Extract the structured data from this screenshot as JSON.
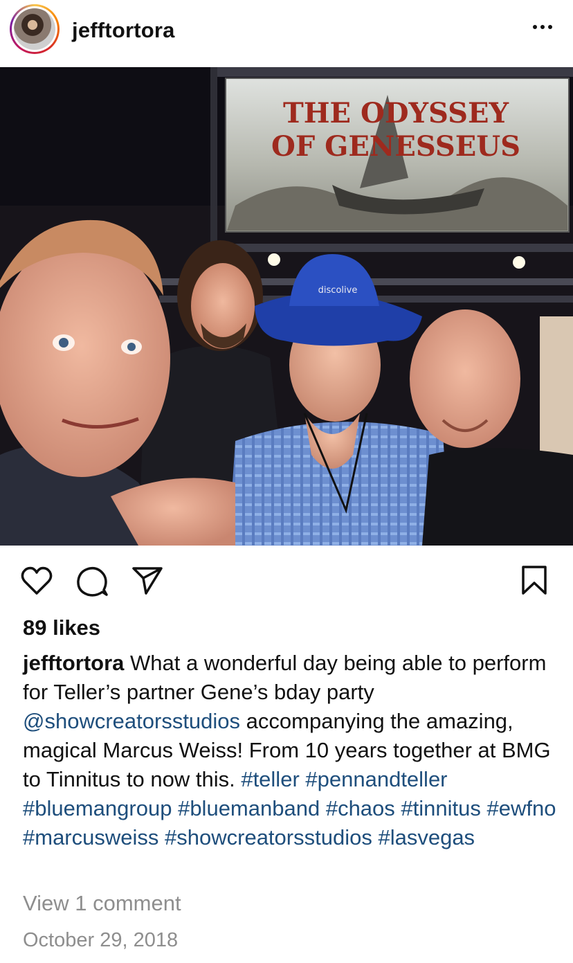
{
  "post": {
    "username": "jefftortora",
    "likes": "89 likes",
    "caption_user": "jefftortora",
    "caption_segments": [
      {
        "text": " What a wonderful day being able to perform for Teller’s partner Gene’s bday party ",
        "link": false
      },
      {
        "text": "@showcreatorsstudios",
        "link": true
      },
      {
        "text": " accompanying the amazing, magical Marcus Weiss! From 10 years together at BMG to Tinnitus to now this. ",
        "link": false
      },
      {
        "text": "#teller",
        "link": true
      },
      {
        "text": " ",
        "link": false
      },
      {
        "text": "#pennandteller",
        "link": true
      },
      {
        "text": " ",
        "link": false
      },
      {
        "text": "#bluemangroup",
        "link": true
      },
      {
        "text": " ",
        "link": false
      },
      {
        "text": "#bluemanband",
        "link": true
      },
      {
        "text": " ",
        "link": false
      },
      {
        "text": "#chaos",
        "link": true
      },
      {
        "text": " ",
        "link": false
      },
      {
        "text": "#tinnitus",
        "link": true
      },
      {
        "text": " ",
        "link": false
      },
      {
        "text": "#ewfno",
        "link": true
      },
      {
        "text": " ",
        "link": false
      },
      {
        "text": "#marcusweiss",
        "link": true
      },
      {
        "text": " ",
        "link": false
      },
      {
        "text": "#showcreatorsstudios",
        "link": true
      },
      {
        "text": " ",
        "link": false
      },
      {
        "text": "#lasvegas",
        "link": true
      }
    ],
    "view_comments": "View 1 comment",
    "date": "October 29, 2018"
  },
  "photo": {
    "banner_line1": "THE ODYSSEY",
    "banner_line2": "OF GENESSEUS",
    "hat_text": "discolive"
  },
  "icons": {
    "more": "more-options-icon",
    "like": "heart-icon",
    "comment": "comment-bubble-icon",
    "share": "paper-plane-icon",
    "save": "bookmark-icon"
  },
  "colors": {
    "link": "#1e4e7c",
    "muted": "#8e8e8e",
    "text": "#111111"
  }
}
